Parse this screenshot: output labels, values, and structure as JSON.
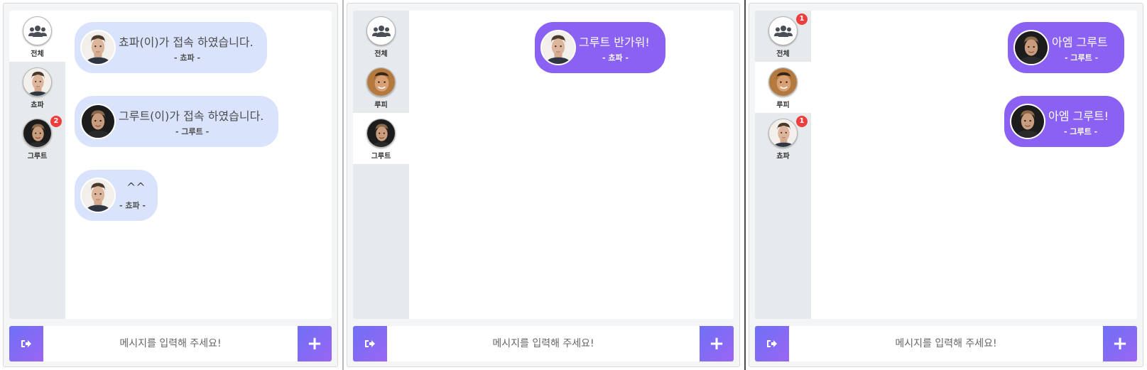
{
  "input_placeholder": "메시지를 입력해 주세요!",
  "colors": {
    "accent": "#8a61f3",
    "bubble_left": "#d9e3fc",
    "badge": "#ee3d3d",
    "sidebar": "#e7eaed"
  },
  "icons": {
    "exit": "sign-out-icon",
    "plus": "plus-icon",
    "group": "users-icon"
  },
  "windows": [
    {
      "sidebar": [
        {
          "label": "전체",
          "active": true
        },
        {
          "label": "쵸파"
        },
        {
          "label": "그루트",
          "badge": "2"
        }
      ],
      "messages": [
        {
          "text": "쵸파(이)가 접속 하였습니다.",
          "sender": "- 쵸파 -"
        },
        {
          "text": "그루트(이)가 접속 하였습니다.",
          "sender": "- 그루트 -"
        },
        {
          "text": "^^",
          "sender": "- 쵸파 -"
        }
      ]
    },
    {
      "sidebar": [
        {
          "label": "전체"
        },
        {
          "label": "루피"
        },
        {
          "label": "그루트",
          "active": true
        }
      ],
      "messages": [
        {
          "text": "그루트 반가워!",
          "sender": "- 쵸파 -"
        }
      ]
    },
    {
      "sidebar": [
        {
          "label": "전체",
          "badge": "1"
        },
        {
          "label": "루피",
          "active": true
        },
        {
          "label": "쵸파",
          "badge": "1"
        }
      ],
      "messages": [
        {
          "text": "아엠 그루트",
          "sender": "- 그루트 -"
        },
        {
          "text": "아엠 그루트!",
          "sender": "- 그루트 -"
        }
      ]
    }
  ]
}
